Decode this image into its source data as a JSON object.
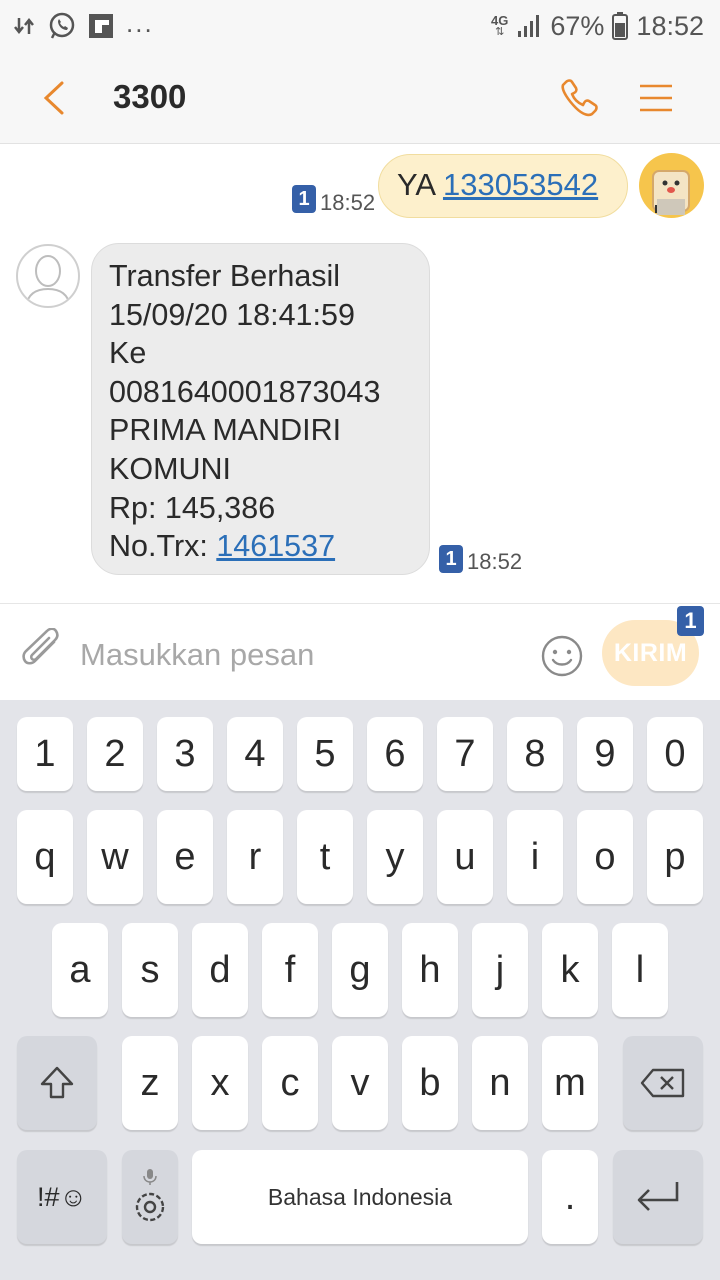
{
  "status_bar": {
    "network": "4G",
    "battery": "67%",
    "time": "18:52",
    "overflow": "...",
    "icons": [
      "data-transfer-icon",
      "whatsapp-icon",
      "flipboard-icon",
      "signal-icon",
      "battery-icon"
    ]
  },
  "header": {
    "title": "3300",
    "icons": [
      "back-arrow-icon",
      "phone-icon",
      "menu-icon"
    ],
    "accent_color": "#e8882e"
  },
  "messages": {
    "sent": {
      "prefix": "YA",
      "link": "133053542",
      "sim": "1",
      "time": "18:52"
    },
    "received": {
      "lines": [
        "Transfer Berhasil",
        "15/09/20 18:41:59",
        "Ke",
        "0081640001873043",
        "PRIMA MANDIRI",
        "KOMUNI",
        "Rp: 145,386"
      ],
      "trx_label": "No.Trx:",
      "trx_link": "1461537",
      "sim": "1",
      "time": "18:52"
    }
  },
  "compose": {
    "placeholder": "Masukkan pesan",
    "send_label": "KIRIM",
    "sim": "1"
  },
  "keyboard": {
    "row1": [
      "1",
      "2",
      "3",
      "4",
      "5",
      "6",
      "7",
      "8",
      "9",
      "0"
    ],
    "row2": [
      "q",
      "w",
      "e",
      "r",
      "t",
      "y",
      "u",
      "i",
      "o",
      "p"
    ],
    "row3": [
      "a",
      "s",
      "d",
      "f",
      "g",
      "h",
      "j",
      "k",
      "l"
    ],
    "row4": [
      "z",
      "x",
      "c",
      "v",
      "b",
      "n",
      "m"
    ],
    "symbols_label": "!#☺",
    "space_label": "Bahasa Indonesia",
    "period": "."
  }
}
